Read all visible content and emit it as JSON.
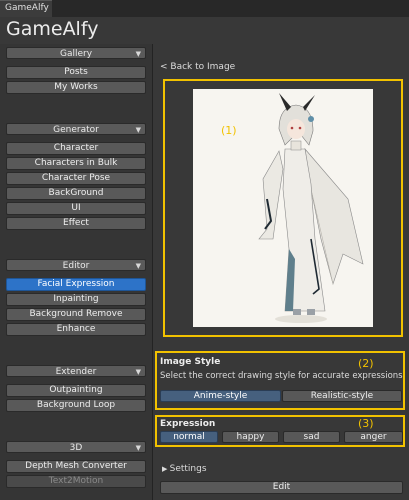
{
  "window": {
    "tab_label": "GameAlfy",
    "app_title": "GameAlfy"
  },
  "sidebar": {
    "sections": [
      {
        "title": "Gallery",
        "items": [
          "Posts",
          "My Works"
        ]
      },
      {
        "title": "Generator",
        "items": [
          "Character",
          "Characters in Bulk",
          "Character Pose",
          "BackGround",
          "UI",
          "Effect"
        ]
      },
      {
        "title": "Editor",
        "items": [
          "Facial Expression",
          "Inpainting",
          "Background Remove",
          "Enhance"
        ],
        "active_item": "Facial Expression"
      },
      {
        "title": "Extender",
        "items": [
          "Outpainting",
          "Background Loop"
        ]
      },
      {
        "title": "3D",
        "items": [
          "Depth Mesh Converter",
          "Text2Motion"
        ],
        "disabled_item": "Text2Motion"
      }
    ]
  },
  "main": {
    "back_link": "< Back to Image",
    "image_callout": "(1)",
    "image_style": {
      "callout": "(2)",
      "title": "Image Style",
      "description": "Select the correct drawing style for accurate expressions",
      "options": [
        "Anime-style",
        "Realistic-style"
      ],
      "selected": "Anime-style"
    },
    "expression": {
      "callout": "(3)",
      "title": "Expression",
      "options": [
        "normal",
        "happy",
        "sad",
        "anger"
      ],
      "selected": "normal"
    },
    "settings_label": "Settings",
    "edit_label": "Edit"
  },
  "colors": {
    "accent_active": "#2d73c8",
    "highlight_frame": "#f2c200",
    "selected_segment": "#46607e"
  }
}
